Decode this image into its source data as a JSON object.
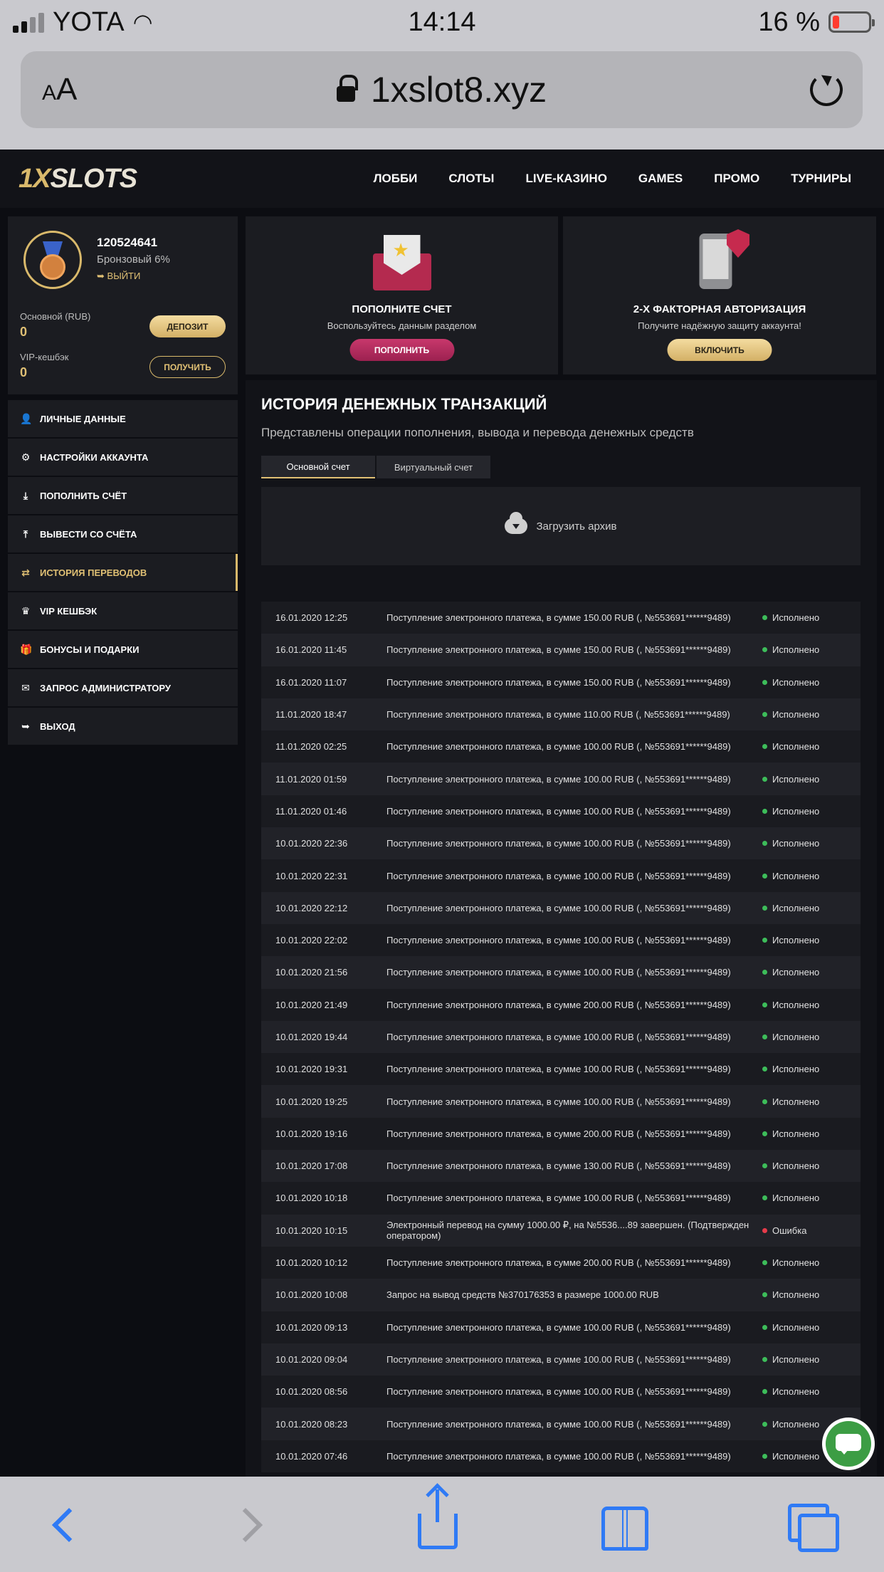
{
  "status_bar": {
    "carrier": "YOTA",
    "time": "14:14",
    "battery": "16 %"
  },
  "browser": {
    "text_size_label": "AA",
    "url": "1xslot8.xyz"
  },
  "site": {
    "logo": "1XSLOTS",
    "nav": [
      "ЛОББИ",
      "СЛОТЫ",
      "LIVE-КАЗИНО",
      "GAMES",
      "ПРОМО",
      "ТУРНИРЫ"
    ]
  },
  "profile": {
    "user_id": "120524641",
    "tier": "Бронзовый 6%",
    "logout": "ВЫЙТИ",
    "main_balance_label": "Основной (RUB)",
    "main_balance": "0",
    "deposit_button": "ДЕПОЗИТ",
    "vip_label": "VIP-кешбэк",
    "vip_balance": "0",
    "claim_button": "ПОЛУЧИТЬ"
  },
  "menu": [
    {
      "label": "ЛИЧНЫЕ ДАННЫЕ",
      "icon": "user-plus-icon",
      "glyph": "👤"
    },
    {
      "label": "НАСТРОЙКИ АККАУНТА",
      "icon": "gears-icon",
      "glyph": "⚙"
    },
    {
      "label": "ПОПОЛНИТЬ СЧЁТ",
      "icon": "download-icon",
      "glyph": "⤓"
    },
    {
      "label": "ВЫВЕСТИ СО СЧЁТА",
      "icon": "upload-icon",
      "glyph": "⤒"
    },
    {
      "label": "ИСТОРИЯ ПЕРЕВОДОВ",
      "icon": "transfer-arrows-icon",
      "glyph": "⇄",
      "active": true
    },
    {
      "label": "VIP КЕШБЭК",
      "icon": "crown-icon",
      "glyph": "♛"
    },
    {
      "label": "БОНУСЫ И ПОДАРКИ",
      "icon": "gift-icon",
      "glyph": "🎁"
    },
    {
      "label": "ЗАПРОС АДМИНИСТРАТОРУ",
      "icon": "envelope-icon",
      "glyph": "✉"
    },
    {
      "label": "ВЫХОД",
      "icon": "sign-out-icon",
      "glyph": "➥"
    }
  ],
  "cards": {
    "deposit": {
      "title": "ПОПОЛНИТЕ СЧЕТ",
      "subtitle": "Воспользуйтесь данным разделом",
      "button": "ПОПОЛНИТЬ"
    },
    "twofa": {
      "title": "2-Х ФАКТОРНАЯ АВТОРИЗАЦИЯ",
      "subtitle": "Получите надёжную защиту аккаунта!",
      "button": "ВКЛЮЧИТЬ"
    }
  },
  "history": {
    "title": "ИСТОРИЯ ДЕНЕЖНЫХ ТРАНЗАКЦИЙ",
    "subtitle": "Представлены операции пополнения, вывода и перевода денежных средств",
    "tabs": [
      "Основной счет",
      "Виртуальный счет"
    ],
    "archive": "Загрузить архив",
    "transactions": [
      {
        "date": "16.01.2020 12:25",
        "desc": "Поступление электронного платежа, в сумме 150.00 RUB (, №553691******9489)",
        "status": "Исполнено",
        "ok": true
      },
      {
        "date": "16.01.2020 11:45",
        "desc": "Поступление электронного платежа, в сумме 150.00 RUB (, №553691******9489)",
        "status": "Исполнено",
        "ok": true
      },
      {
        "date": "16.01.2020 11:07",
        "desc": "Поступление электронного платежа, в сумме 150.00 RUB (, №553691******9489)",
        "status": "Исполнено",
        "ok": true
      },
      {
        "date": "11.01.2020 18:47",
        "desc": "Поступление электронного платежа, в сумме 110.00 RUB (, №553691******9489)",
        "status": "Исполнено",
        "ok": true
      },
      {
        "date": "11.01.2020 02:25",
        "desc": "Поступление электронного платежа, в сумме 100.00 RUB (, №553691******9489)",
        "status": "Исполнено",
        "ok": true
      },
      {
        "date": "11.01.2020 01:59",
        "desc": "Поступление электронного платежа, в сумме 100.00 RUB (, №553691******9489)",
        "status": "Исполнено",
        "ok": true
      },
      {
        "date": "11.01.2020 01:46",
        "desc": "Поступление электронного платежа, в сумме 100.00 RUB (, №553691******9489)",
        "status": "Исполнено",
        "ok": true
      },
      {
        "date": "10.01.2020 22:36",
        "desc": "Поступление электронного платежа, в сумме 100.00 RUB (, №553691******9489)",
        "status": "Исполнено",
        "ok": true
      },
      {
        "date": "10.01.2020 22:31",
        "desc": "Поступление электронного платежа, в сумме 100.00 RUB (, №553691******9489)",
        "status": "Исполнено",
        "ok": true
      },
      {
        "date": "10.01.2020 22:12",
        "desc": "Поступление электронного платежа, в сумме 100.00 RUB (, №553691******9489)",
        "status": "Исполнено",
        "ok": true
      },
      {
        "date": "10.01.2020 22:02",
        "desc": "Поступление электронного платежа, в сумме 100.00 RUB (, №553691******9489)",
        "status": "Исполнено",
        "ok": true
      },
      {
        "date": "10.01.2020 21:56",
        "desc": "Поступление электронного платежа, в сумме 100.00 RUB (, №553691******9489)",
        "status": "Исполнено",
        "ok": true
      },
      {
        "date": "10.01.2020 21:49",
        "desc": "Поступление электронного платежа, в сумме 200.00 RUB (, №553691******9489)",
        "status": "Исполнено",
        "ok": true
      },
      {
        "date": "10.01.2020 19:44",
        "desc": "Поступление электронного платежа, в сумме 100.00 RUB (, №553691******9489)",
        "status": "Исполнено",
        "ok": true
      },
      {
        "date": "10.01.2020 19:31",
        "desc": "Поступление электронного платежа, в сумме 100.00 RUB (, №553691******9489)",
        "status": "Исполнено",
        "ok": true
      },
      {
        "date": "10.01.2020 19:25",
        "desc": "Поступление электронного платежа, в сумме 100.00 RUB (, №553691******9489)",
        "status": "Исполнено",
        "ok": true
      },
      {
        "date": "10.01.2020 19:16",
        "desc": "Поступление электронного платежа, в сумме 200.00 RUB (, №553691******9489)",
        "status": "Исполнено",
        "ok": true
      },
      {
        "date": "10.01.2020 17:08",
        "desc": "Поступление электронного платежа, в сумме 130.00 RUB (, №553691******9489)",
        "status": "Исполнено",
        "ok": true
      },
      {
        "date": "10.01.2020 10:18",
        "desc": "Поступление электронного платежа, в сумме 100.00 RUB (, №553691******9489)",
        "status": "Исполнено",
        "ok": true
      },
      {
        "date": "10.01.2020 10:15",
        "desc": "Электронный перевод на сумму 1000.00 ₽, на №5536....89 завершен. (Подтвержден оператором)",
        "status": "Ошибка",
        "ok": false
      },
      {
        "date": "10.01.2020 10:12",
        "desc": "Поступление электронного платежа, в сумме 200.00 RUB (, №553691******9489)",
        "status": "Исполнено",
        "ok": true
      },
      {
        "date": "10.01.2020 10:08",
        "desc": "Запрос на вывод средств №370176353 в размере 1000.00 RUB",
        "status": "Исполнено",
        "ok": true
      },
      {
        "date": "10.01.2020 09:13",
        "desc": "Поступление электронного платежа, в сумме 100.00 RUB (, №553691******9489)",
        "status": "Исполнено",
        "ok": true
      },
      {
        "date": "10.01.2020 09:04",
        "desc": "Поступление электронного платежа, в сумме 100.00 RUB (, №553691******9489)",
        "status": "Исполнено",
        "ok": true
      },
      {
        "date": "10.01.2020 08:56",
        "desc": "Поступление электронного платежа, в сумме 100.00 RUB (, №553691******9489)",
        "status": "Исполнено",
        "ok": true
      },
      {
        "date": "10.01.2020 08:23",
        "desc": "Поступление электронного платежа, в сумме 100.00 RUB (, №553691******9489)",
        "status": "Исполнено",
        "ok": true
      },
      {
        "date": "10.01.2020 07:46",
        "desc": "Поступление электронного платежа, в сумме 100.00 RUB (, №553691******9489)",
        "status": "Исполнено",
        "ok": true
      }
    ]
  },
  "colors": {
    "accent_gold": "#d9b96b",
    "accent_red": "#c8386c",
    "status_ok": "#3dbd5a",
    "status_error": "#e63b4a",
    "ios_blue": "#2f7af5"
  }
}
